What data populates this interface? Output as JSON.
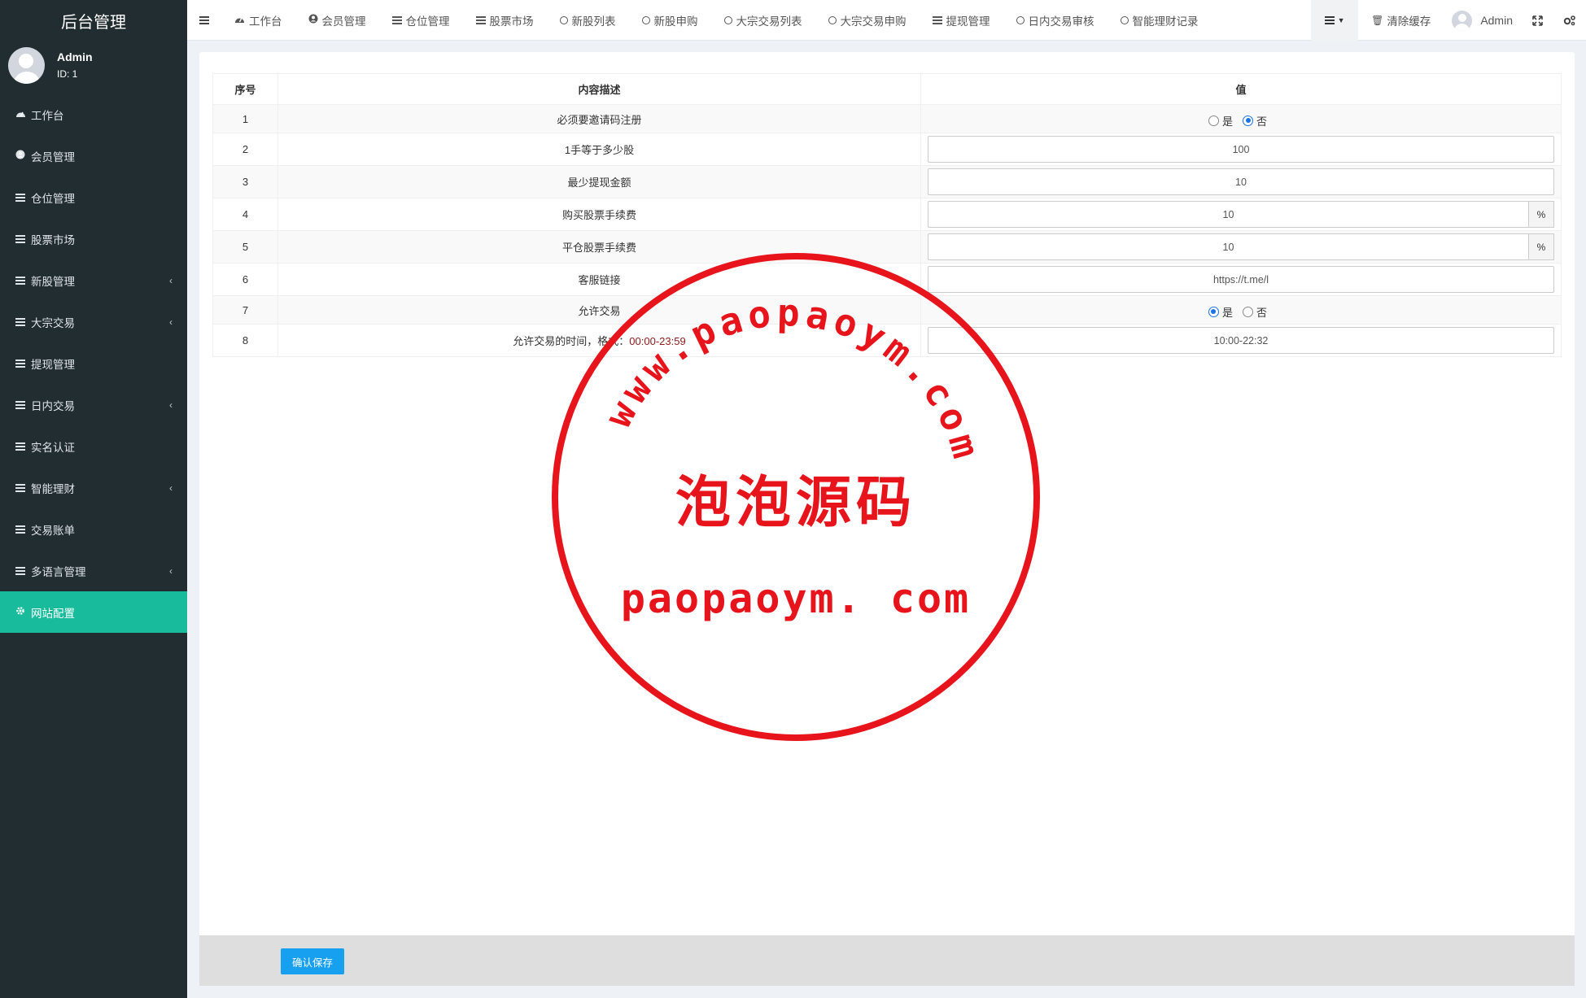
{
  "sidebar": {
    "brand": "后台管理",
    "user": {
      "name": "Admin",
      "id": "ID: 1"
    },
    "items": [
      {
        "label": "工作台",
        "icon": "dashboard-icon",
        "expandable": false
      },
      {
        "label": "会员管理",
        "icon": "user-circle-icon",
        "expandable": false
      },
      {
        "label": "仓位管理",
        "icon": "bars-icon",
        "expandable": false
      },
      {
        "label": "股票市场",
        "icon": "bars-icon",
        "expandable": false
      },
      {
        "label": "新股管理",
        "icon": "bars-icon",
        "expandable": true
      },
      {
        "label": "大宗交易",
        "icon": "bars-icon",
        "expandable": true
      },
      {
        "label": "提现管理",
        "icon": "bars-icon",
        "expandable": false
      },
      {
        "label": "日内交易",
        "icon": "bars-icon",
        "expandable": true
      },
      {
        "label": "实名认证",
        "icon": "bars-icon",
        "expandable": false
      },
      {
        "label": "智能理财",
        "icon": "bars-icon",
        "expandable": true
      },
      {
        "label": "交易账单",
        "icon": "bars-icon",
        "expandable": false
      },
      {
        "label": "多语言管理",
        "icon": "bars-icon",
        "expandable": true
      },
      {
        "label": "网站配置",
        "icon": "gear-icon",
        "expandable": false,
        "active": true
      }
    ],
    "chevron": "‹"
  },
  "topnav": {
    "tabs": [
      {
        "label": "工作台",
        "icon": "dashboard-icon"
      },
      {
        "label": "会员管理",
        "icon": "user-circle-icon"
      },
      {
        "label": "仓位管理",
        "icon": "bars-icon"
      },
      {
        "label": "股票市场",
        "icon": "bars-icon"
      },
      {
        "label": "新股列表",
        "icon": "circle-icon"
      },
      {
        "label": "新股申购",
        "icon": "circle-icon"
      },
      {
        "label": "大宗交易列表",
        "icon": "circle-icon"
      },
      {
        "label": "大宗交易申购",
        "icon": "circle-icon"
      },
      {
        "label": "提现管理",
        "icon": "bars-icon"
      },
      {
        "label": "日内交易审核",
        "icon": "circle-icon"
      },
      {
        "label": "智能理财记录",
        "icon": "circle-icon"
      }
    ],
    "clear_cache": "清除缓存",
    "admin_name": "Admin"
  },
  "table": {
    "headers": [
      "序号",
      "内容描述",
      "值"
    ],
    "rows": [
      {
        "no": "1",
        "desc": "必须要邀请码注册",
        "type": "radio",
        "options": [
          "是",
          "否"
        ],
        "selected": 1
      },
      {
        "no": "2",
        "desc": "1手等于多少股",
        "type": "input",
        "value": "100"
      },
      {
        "no": "3",
        "desc": "最少提现金额",
        "type": "input",
        "value": "10"
      },
      {
        "no": "4",
        "desc": "购买股票手续费",
        "type": "input-addon",
        "value": "10",
        "addon": "%"
      },
      {
        "no": "5",
        "desc": "平仓股票手续费",
        "type": "input-addon",
        "value": "10",
        "addon": "%"
      },
      {
        "no": "6",
        "desc": "客服链接",
        "type": "input",
        "value": "https://t.me/l"
      },
      {
        "no": "7",
        "desc": "允许交易",
        "type": "radio",
        "options": [
          "是",
          "否"
        ],
        "selected": 0
      },
      {
        "no": "8",
        "desc": "允许交易的时间，格式：",
        "desc_extra": "00:00-23:59",
        "type": "input",
        "value": "10:00-22:32"
      }
    ]
  },
  "footer": {
    "save_label": "确认保存"
  },
  "watermark": {
    "arc_text": "www.paopaoym.com",
    "center_cn": "泡泡源码",
    "bottom_text": "paopaoym. com",
    "color": "#e8141c"
  },
  "colors": {
    "sidebar_bg": "#222d32",
    "active": "#18bc9c",
    "primary_btn": "#18a0f0"
  }
}
